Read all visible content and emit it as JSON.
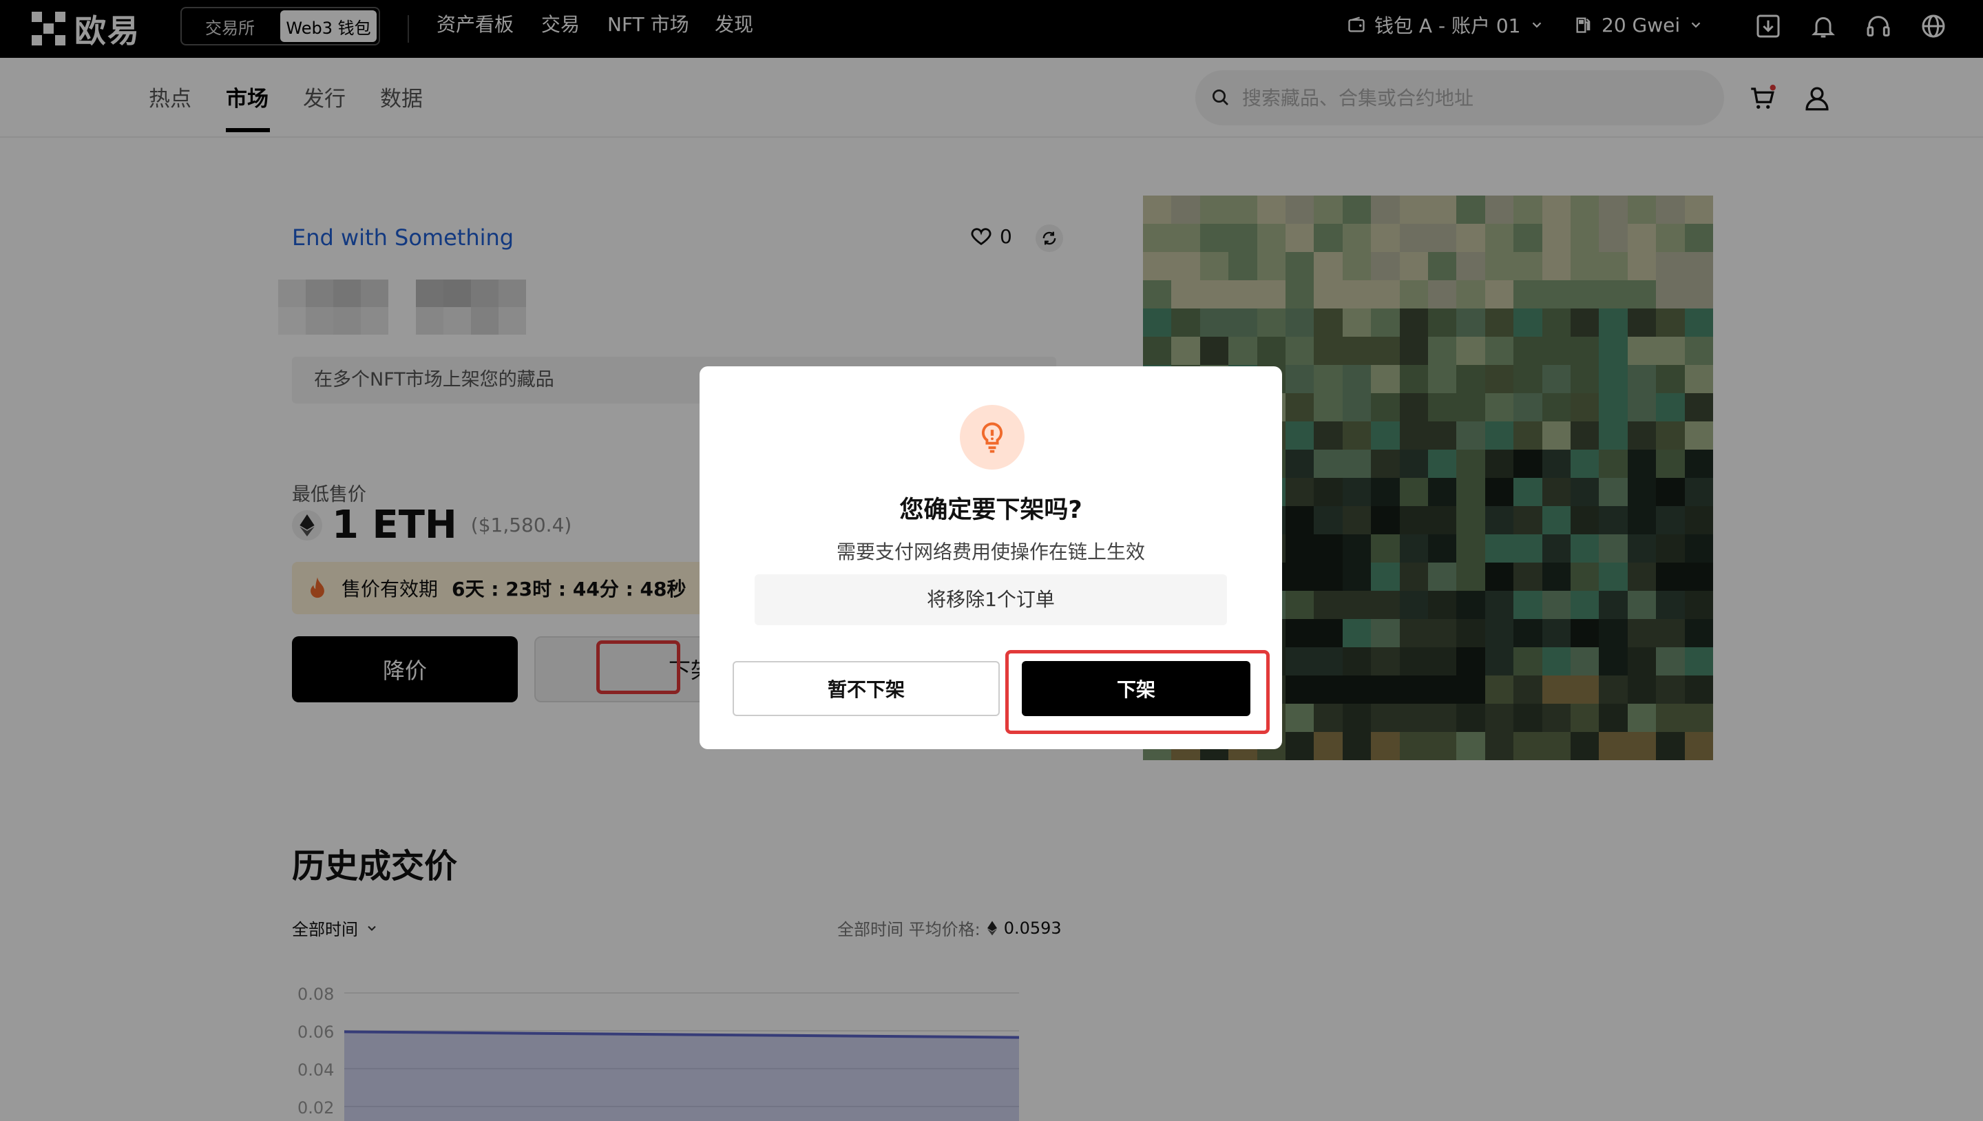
{
  "topnav": {
    "brand": "欧易",
    "exchange_tab": "交易所",
    "web3_tab": "Web3 钱包",
    "links": [
      "资产看板",
      "交易",
      "NFT 市场",
      "发现"
    ],
    "wallet_label": "钱包 A - 账户 01",
    "gas_label": "20 Gwei"
  },
  "subnav": {
    "tabs": [
      "热点",
      "市场",
      "发行",
      "数据"
    ],
    "active_tab": "市场",
    "search_placeholder": "搜索藏品、合集或合约地址"
  },
  "nft": {
    "collection": "End with Something",
    "likes": "0",
    "multi_market_text": "在多个NFT市场上架您的藏品",
    "lowest_price_label": "最低售价",
    "price": "1 ETH",
    "price_usd": "($1,580.4)",
    "expiry_label": "售价有效期",
    "expiry_value": "6天 : 23时 : 44分 : 48秒",
    "reduce_button": "降价",
    "delist_button": "下架"
  },
  "history": {
    "title": "历史成交价",
    "filter": "全部时间",
    "avg_label": "全部时间 平均价格:",
    "avg_value": "0.0593"
  },
  "chart_data": {
    "type": "area",
    "title": "",
    "xlabel": "",
    "ylabel": "",
    "ylim": [
      0.02,
      0.08
    ],
    "y_ticks": [
      "0.08",
      "0.06",
      "0.04",
      "0.02"
    ],
    "series": [
      {
        "values": [
          0.0595,
          0.0565
        ]
      }
    ],
    "color": "#5b64c8"
  },
  "modal": {
    "title": "您确定要下架吗?",
    "subtitle": "需要支付网络费用使操作在链上生效",
    "info": "将移除1个订单",
    "cancel": "暂不下架",
    "confirm": "下架"
  },
  "colors": {
    "accent_blue": "#1f5fd6",
    "highlight_red": "#e23a3a",
    "icon_orange": "#f06a2c"
  }
}
